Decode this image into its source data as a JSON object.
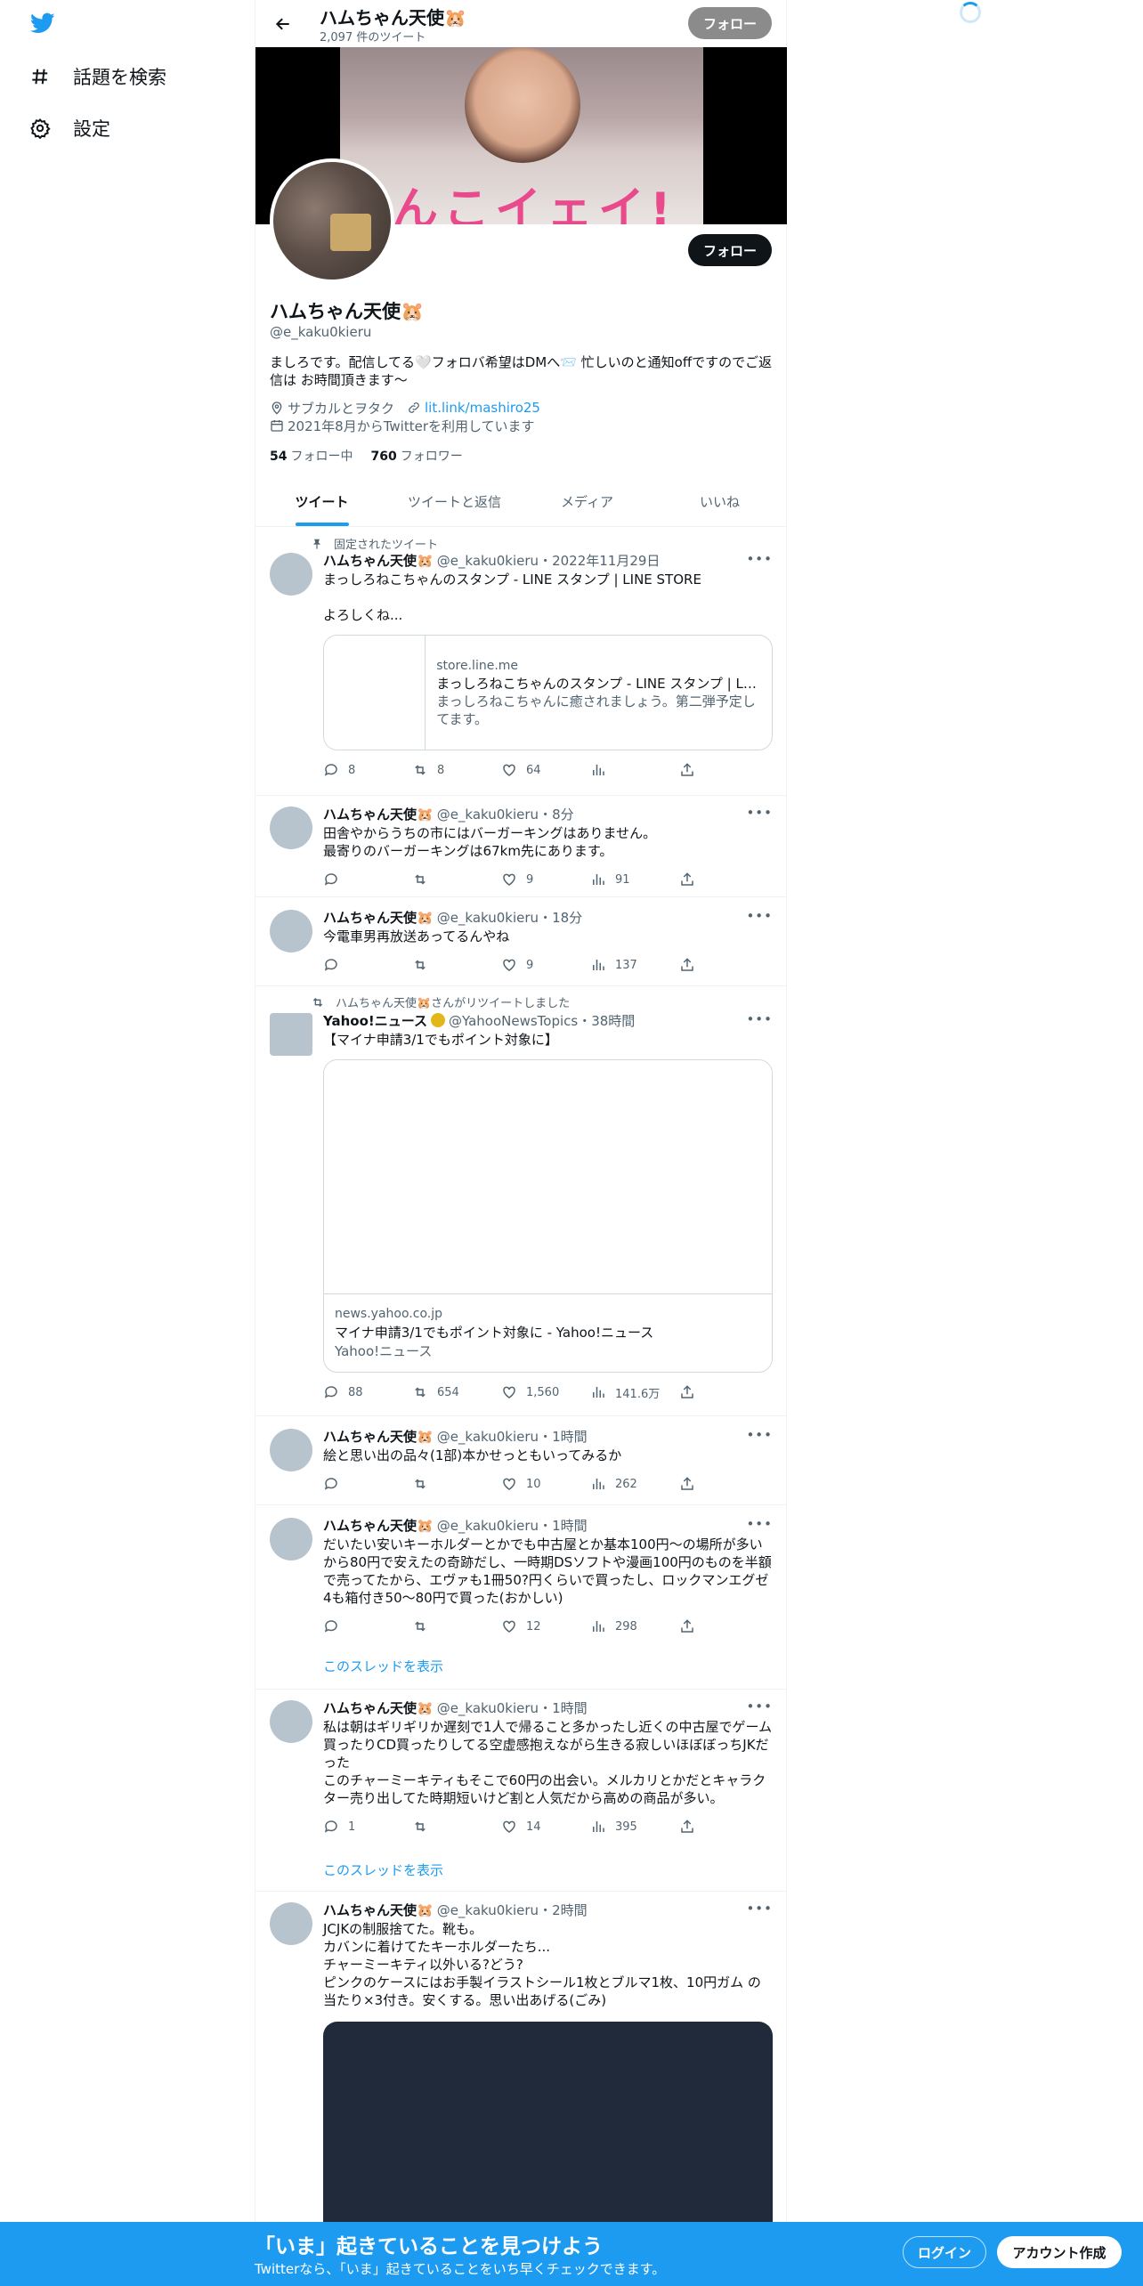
{
  "nav": {
    "explore_label": "話題を検索",
    "settings_label": "設定"
  },
  "header": {
    "name": "ハムちゃん天使🐹",
    "tweet_count": "2,097 件のツイート",
    "follow_label": "フォロー"
  },
  "profile": {
    "banner_text": "うんこイェイ!",
    "follow_label": "フォロー",
    "name": "ハムちゃん天使🐹",
    "handle": "@e_kaku0kieru",
    "bio": "ましろです。配信してる🤍フォロバ希望はDMへ📨 忙しいのと通知offですのでご返信は お時間頂きます〜",
    "location": "サブカルとヲタク",
    "link": "lit.link/mashiro25",
    "joined": "2021年8月からTwitterを利用しています",
    "following_count": "54",
    "following_label": "フォロー中",
    "followers_count": "760",
    "followers_label": "フォロワー"
  },
  "tabs": [
    {
      "label": "ツイート"
    },
    {
      "label": "ツイートと返信"
    },
    {
      "label": "メディア"
    },
    {
      "label": "いいね"
    }
  ],
  "tweets": [
    {
      "context": "固定されたツイート",
      "name": "ハムちゃん天使🐹",
      "handle": "@e_kaku0kieru・2022年11月29日",
      "text": "まっしろねこちゃんのスタンプ - LINE スタンプ | LINE STORE\n\nよろしくね...",
      "card": {
        "domain": "store.line.me",
        "title": "まっしろねこちゃんのスタンプ - LINE スタンプ | LINE STORE",
        "desc": "まっしろねこちゃんに癒されましょう。第二弾予定してます。"
      },
      "replies": "8",
      "retweets": "8",
      "likes": "64",
      "views": ""
    },
    {
      "name": "ハムちゃん天使🐹",
      "handle": "@e_kaku0kieru・8分",
      "text": "田舎やからうちの市にはバーガーキングはありません。\n最寄りのバーガーキングは67km先にあります。",
      "replies": "",
      "retweets": "",
      "likes": "9",
      "views": "91"
    },
    {
      "name": "ハムちゃん天使🐹",
      "handle": "@e_kaku0kieru・18分",
      "text": "今電車男再放送あってるんやね",
      "replies": "",
      "retweets": "",
      "likes": "9",
      "views": "137"
    },
    {
      "context": "ハムちゃん天使🐹さんがリツイートしました",
      "name": "Yahoo!ニュース",
      "handle": "@YahooNewsTopics・38時間",
      "text": "【マイナ申請3/1でもポイント対象に】",
      "card": {
        "domain": "news.yahoo.co.jp",
        "title": "マイナ申請3/1でもポイント対象に - Yahoo!ニュース",
        "desc": "Yahoo!ニュース"
      },
      "replies": "88",
      "retweets": "654",
      "likes": "1,560",
      "views": "141.6万"
    },
    {
      "name": "ハムちゃん天使🐹",
      "handle": "@e_kaku0kieru・1時間",
      "text": "絵と思い出の品々(1部)本かせっともいってみるか",
      "replies": "",
      "retweets": "",
      "likes": "10",
      "views": "262"
    },
    {
      "name": "ハムちゃん天使🐹",
      "handle": "@e_kaku0kieru・1時間",
      "text": "だいたい安いキーホルダーとかでも中古屋とか基本100円〜の場所が多いから80円で安えたの奇跡だし、一時期DSソフトや漫画100円のものを半額で売ってたから、エヴァも1冊50?円くらいで買ったし、ロックマンエグゼ4も箱付き50〜80円で買った(おかしい)",
      "thread": "このスレッドを表示",
      "replies": "",
      "retweets": "",
      "likes": "12",
      "views": "298"
    },
    {
      "name": "ハムちゃん天使🐹",
      "handle": "@e_kaku0kieru・1時間",
      "text": "私は朝はギリギリか遅刻で1人で帰ること多かったし近くの中古屋でゲーム買ったりCD買ったりしてる空虚感抱えながら生きる寂しいほぼぼっちJKだった\nこのチャーミーキティもそこで60円の出会い。メルカリとかだとキャラクター売り出してた時期短いけど割と人気だから高めの商品が多い。",
      "thread": "このスレッドを表示",
      "replies": "1",
      "retweets": "",
      "likes": "14",
      "views": "395"
    },
    {
      "name": "ハムちゃん天使🐹",
      "handle": "@e_kaku0kieru・2時間",
      "text": "JCJKの制服捨てた。靴も。\nカバンに着けてたキーホルダーたち...\nチャーミーキティ以外いる?どう?\nピンクのケースにはお手製イラストシール1枚とブルマ1枚、10円ガム の当たり×3付き。安くする。思い出あげる(ごみ)"
    }
  ],
  "bottom": {
    "title": "「いま」起きていることを見つけよう",
    "subtitle": "Twitterなら、「いま」起きていることをいち早くチェックできます。",
    "login_label": "ログイン",
    "signup_label": "アカウント作成"
  }
}
